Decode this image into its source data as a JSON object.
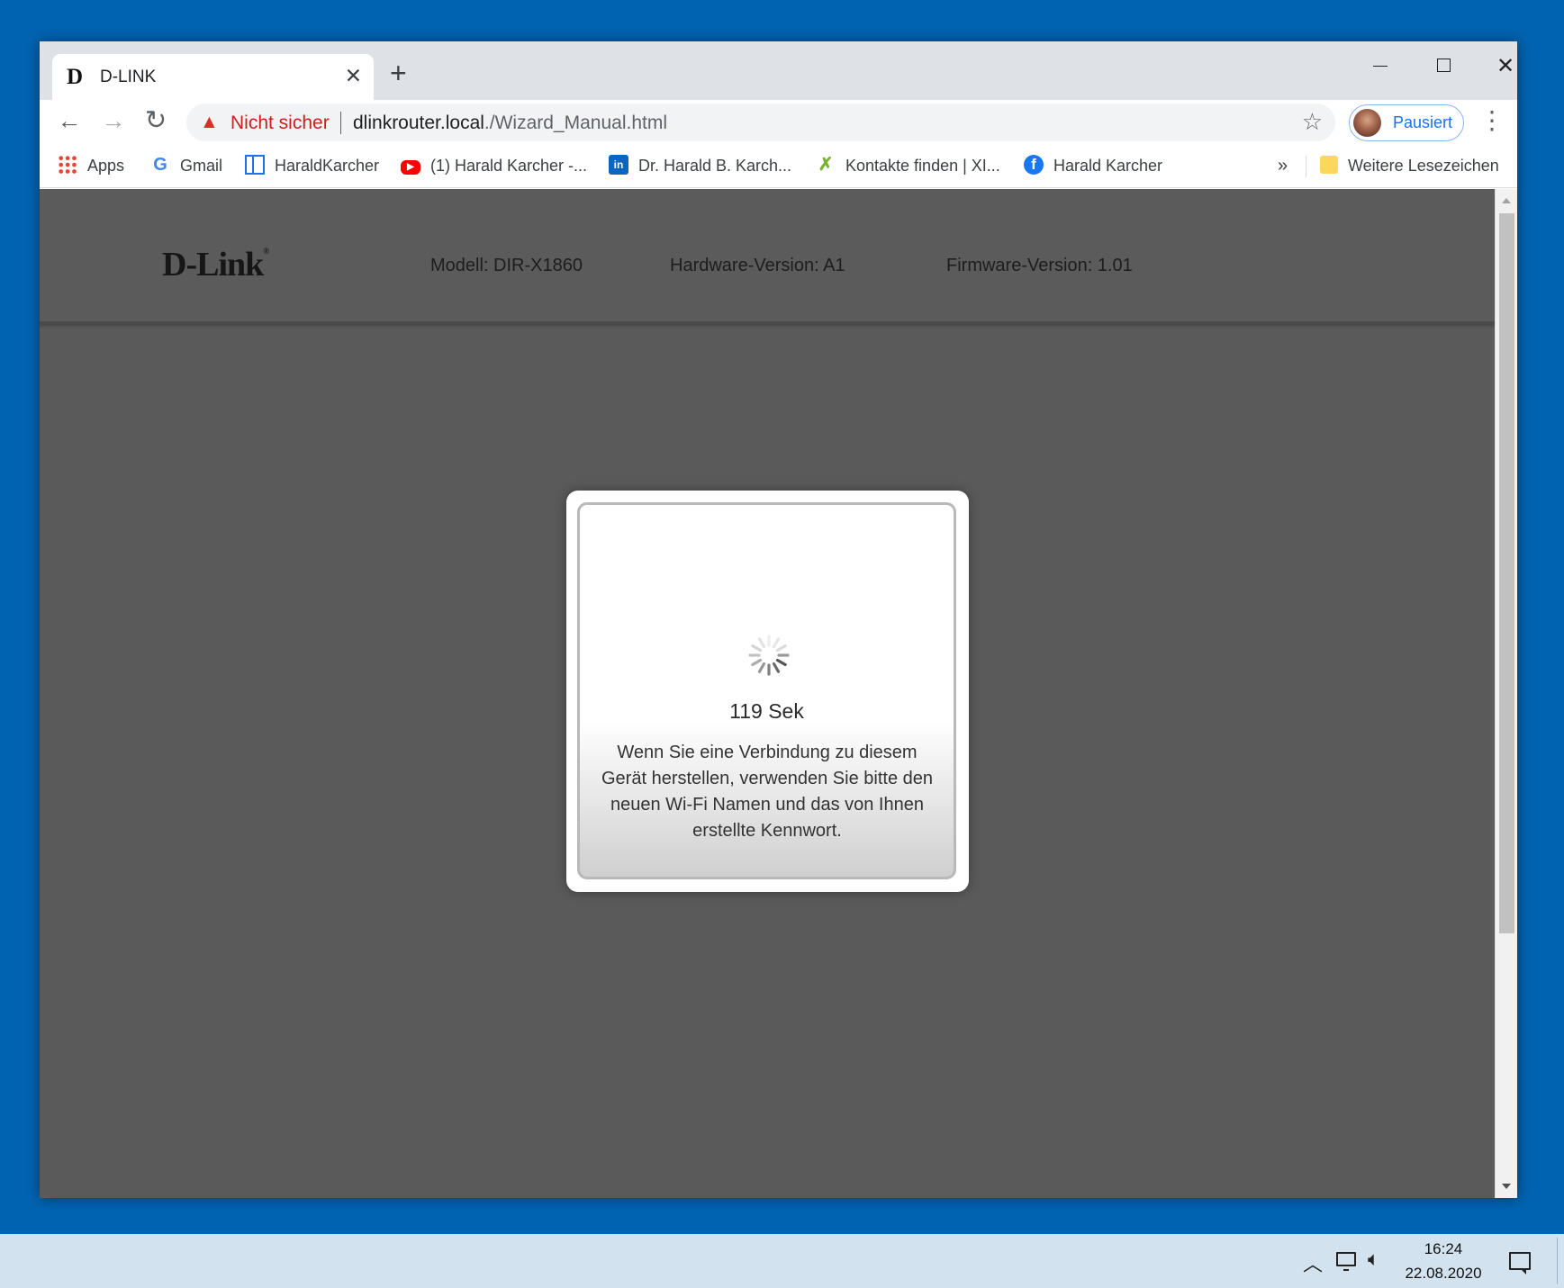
{
  "browser": {
    "tab": {
      "title": "D-LINK",
      "favicon_letter": "D"
    },
    "nav": {
      "back_icon": "←",
      "forward_icon": "→",
      "reload_icon": "↻"
    },
    "address_bar": {
      "security_label": "Nicht sicher",
      "url_host": "dlinkrouter.local",
      "url_path": "./Wizard_Manual.html"
    },
    "profile": {
      "label": "Pausiert"
    },
    "bookmarks": [
      {
        "label": "Apps",
        "icon": "apps-grid-icon"
      },
      {
        "label": "Gmail",
        "icon": "google-icon"
      },
      {
        "label": "HaraldKarcher",
        "icon": "site-layout-icon"
      },
      {
        "label": "(1) Harald Karcher -...",
        "icon": "youtube-icon"
      },
      {
        "label": "Dr. Harald B. Karch...",
        "icon": "linkedin-icon"
      },
      {
        "label": "Kontakte finden | XI...",
        "icon": "xing-icon"
      },
      {
        "label": "Harald Karcher",
        "icon": "facebook-icon"
      }
    ],
    "bookmarks_overflow": "»",
    "other_bookmarks": {
      "label": "Weitere Lesezeichen",
      "icon": "folder-icon"
    }
  },
  "router": {
    "logo": "D-Link",
    "model": "Modell: DIR-X1860",
    "hardware": "Hardware-Version: A1",
    "firmware": "Firmware-Version: 1.01"
  },
  "dialog": {
    "countdown": "119 Sek",
    "message": "Wenn Sie eine Verbindung zu diesem Gerät herstellen, verwenden Sie bitte den neuen Wi-Fi Namen und das von Ihnen erstellte Kennwort."
  },
  "taskbar": {
    "time": "16:24",
    "date": "22.08.2020"
  },
  "colors": {
    "desktop": "#0063b1",
    "page_bg": "#5a5a5a",
    "warning": "#c5221f",
    "profile_accent": "#1a73e8"
  }
}
